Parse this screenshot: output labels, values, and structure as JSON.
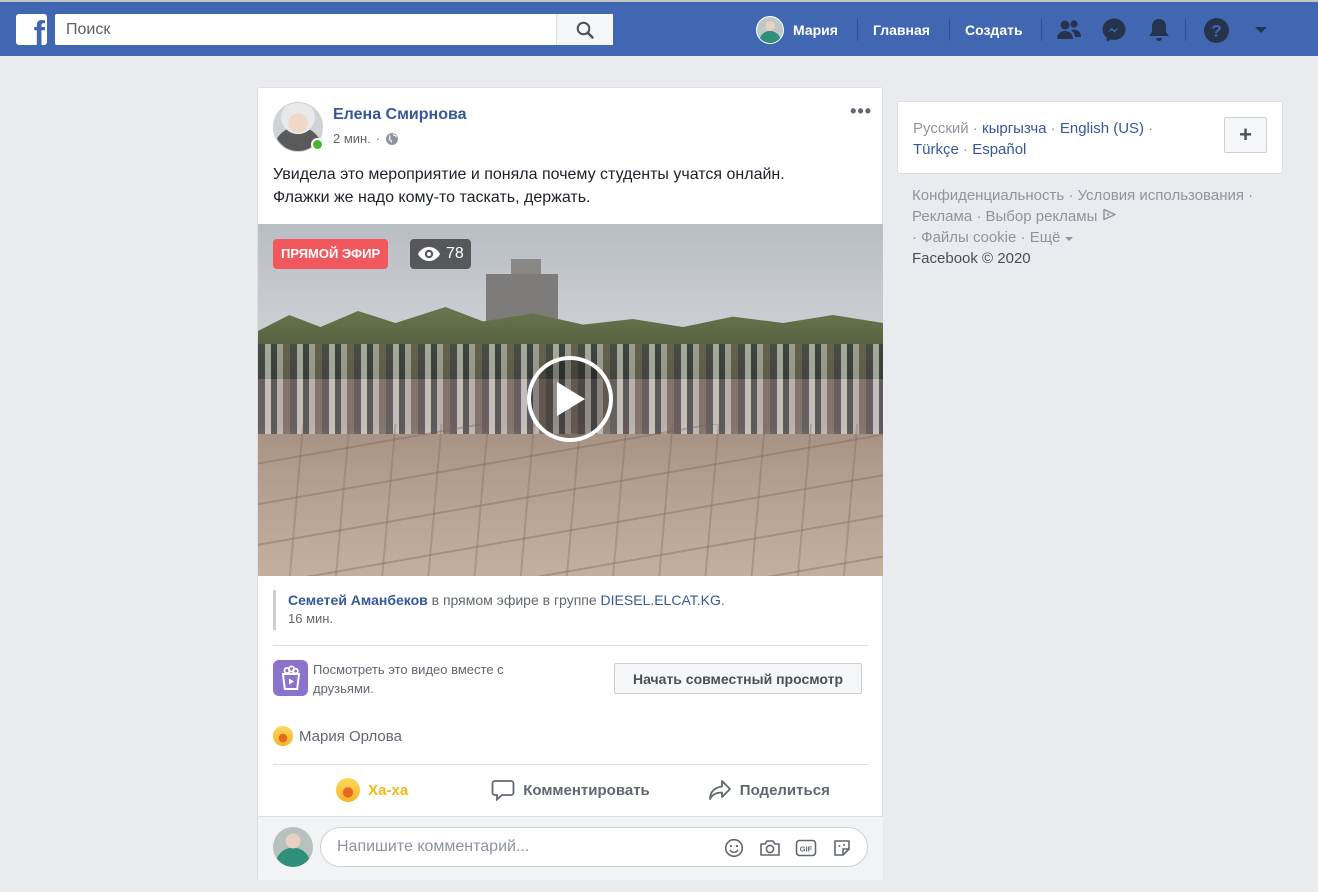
{
  "header": {
    "logo": "f",
    "search_placeholder": "Поиск",
    "user_name": "Мария",
    "home_label": "Главная",
    "create_label": "Создать"
  },
  "post": {
    "author": "Елена Смирнова",
    "time": "2 мин.",
    "text_line1": "Увидела это мероприятие и поняла почему студенты учатся онлайн.",
    "text_line2": "Флажки же надо кому-то таскать, держать.",
    "live_badge": "ПРЯМОЙ ЭФИР",
    "viewer_count": "78",
    "shared": {
      "name": "Семетей Аманбеков",
      "middle": " в прямом эфире в группе ",
      "group": "DIESEL.ELCAT.KG",
      "dot": ".",
      "time": "16 мин."
    },
    "watch_party_text": "Посмотреть это видео вместе с друзьями.",
    "watch_party_button": "Начать совместный просмотр",
    "reactor": "Мария Орлова",
    "actions": {
      "haha": "Ха-ха",
      "comment": "Комментировать",
      "share": "Поделиться"
    },
    "comment_placeholder": "Напишите комментарий..."
  },
  "sidebar": {
    "languages": {
      "current": "Русский",
      "options": [
        "кыргызча",
        "English (US)",
        "Türkçe",
        "Español"
      ],
      "separator": " · "
    },
    "add_language": "+",
    "footer": {
      "links": [
        "Конфиденциальность",
        "Условия использования",
        "Реклама",
        "Выбор рекламы",
        "Файлы cookie",
        "Ещё"
      ],
      "copyright": "Facebook © 2020"
    }
  },
  "colors": {
    "brand": "#4267b2",
    "link": "#365899",
    "live": "#f0585d",
    "haha": "#f0ba15",
    "watch_party": "#8c72cb"
  }
}
